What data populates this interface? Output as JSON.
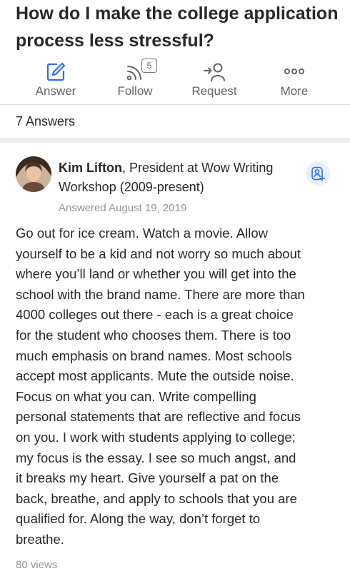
{
  "question": {
    "title": "How do I make the college application process less stressful?"
  },
  "actions": {
    "answer_label": "Answer",
    "follow_label": "Follow",
    "follow_count": "5",
    "request_label": "Request",
    "more_label": "More"
  },
  "answers_header": {
    "count_label": "7 Answers"
  },
  "answer": {
    "author_name": "Kim Lifton",
    "author_credential": ", President at Wow Writing Workshop (2009-present)",
    "answered_date": "Answered August 19, 2019",
    "body_lines": [
      "Go out for ice cream. Watch a movie. Allow",
      "yourself to be a kid and not worry so much about",
      "where you’ll land or whether you will get into the",
      "school with the brand name. There are more than",
      "4000 colleges out there - each is a great choice",
      "for the student who chooses them. There is too",
      "much emphasis on brand names. Most schools",
      "accept most applicants. Mute the outside noise.",
      "Focus on what you can. Write compelling",
      "personal statements that are reflective and focus",
      "on you. I work with students applying to college;",
      "my focus is the essay. I see so much angst, and",
      "it breaks my heart. Give yourself a pat on the",
      "back, breathe, and apply to schools that you are",
      "qualified for. Along the way, don’t forget to",
      "breathe."
    ],
    "views": "80 views"
  },
  "colors": {
    "accent_blue": "#2e69ff",
    "icon_gray": "#636466",
    "text_primary": "#282829",
    "text_secondary": "#939598"
  }
}
